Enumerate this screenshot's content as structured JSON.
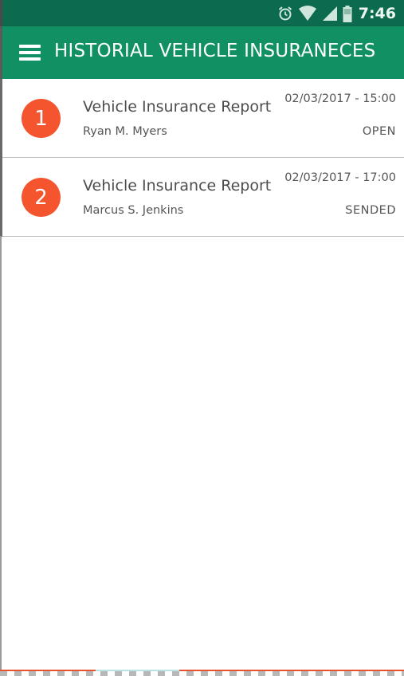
{
  "status_bar": {
    "time": "7:46",
    "icons": [
      "alarm-icon",
      "wifi-icon",
      "signal-icon",
      "battery-icon"
    ]
  },
  "app_bar": {
    "title": "HISTORIAL VEHICLE INSURANECES",
    "menu_icon": "hamburger-menu-icon"
  },
  "colors": {
    "status_bar": "#0c6b4f",
    "app_bar": "#109063",
    "badge": "#f4552e",
    "text": "#4d4d4d"
  },
  "reports": [
    {
      "number": "1",
      "title": "Vehicle Insurance Report",
      "name": "Ryan M. Myers",
      "date": "02/03/2017 - 15:00",
      "status": "OPEN"
    },
    {
      "number": "2",
      "title": "Vehicle Insurance Report",
      "name": "Marcus S. Jenkins",
      "date": "02/03/2017 - 17:00",
      "status": "SENDED"
    }
  ]
}
